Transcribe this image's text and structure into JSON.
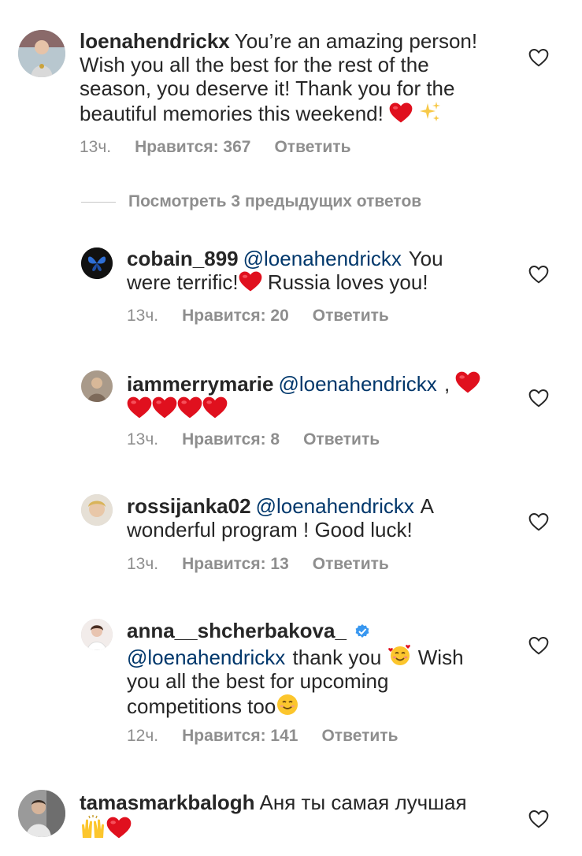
{
  "comments": [
    {
      "username": "loenahendrickx",
      "text": "You’re an amazing person! Wish you all the best for the rest of the season, you deserve it! Thank you for the beautiful memories this weekend!",
      "emoji_after": [
        "heart",
        "sparkles"
      ],
      "time": "13ч.",
      "likes": "Нравится: 367",
      "reply": "Ответить"
    }
  ],
  "view_previous": "Посмотреть 3 предыдущих ответов",
  "replies": [
    {
      "username": "cobain_899",
      "mention": "@loenahendrickx",
      "text_a": "You were terrific!",
      "text_b": "Russia loves you!",
      "time": "13ч.",
      "likes": "Нравится: 20",
      "reply": "Ответить"
    },
    {
      "username": "iammerrymarie",
      "mention": "@loenahendrickx",
      "text_a": ",",
      "time": "13ч.",
      "likes": "Нравится: 8",
      "reply": "Ответить"
    },
    {
      "username": "rossijanka02",
      "mention": "@loenahendrickx",
      "text_a": "A wonderful program ! Good luck!",
      "time": "13ч.",
      "likes": "Нравится: 13",
      "reply": "Ответить"
    },
    {
      "username": "anna__shcherbakova_",
      "mention": "@loenahendrickx",
      "text_a": "thank you",
      "text_b": "Wish you all the best for upcoming competitions too",
      "time": "12ч.",
      "likes": "Нравится: 141",
      "reply": "Ответить"
    }
  ],
  "last_comment": {
    "username": "tamasmarkbalogh",
    "text": "Аня ты самая лучшая"
  },
  "colors": {
    "text": "#262626",
    "meta": "#8e8e8e",
    "mention": "#00376b",
    "heart_emoji": "#e0101e",
    "verified": "#3897f0"
  }
}
